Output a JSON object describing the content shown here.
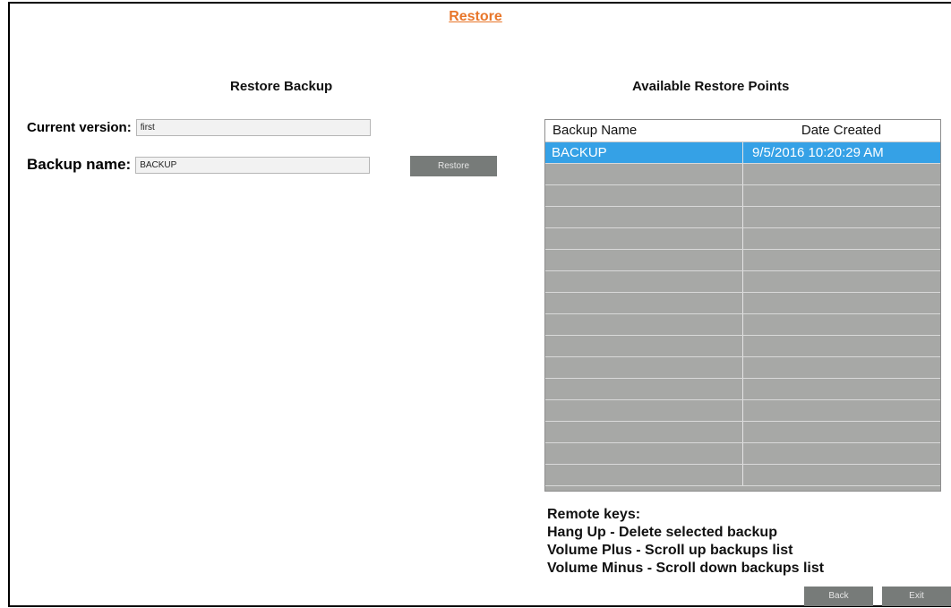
{
  "page": {
    "title": "Restore"
  },
  "left": {
    "title": "Restore Backup",
    "current_version_label": "Current version:",
    "current_version_value": "first",
    "backup_name_label": "Backup name:",
    "backup_name_value": "BACKUP",
    "restore_button": "Restore"
  },
  "right": {
    "title": "Available Restore Points",
    "columns": [
      "Backup Name",
      "Date Created"
    ],
    "rows": [
      {
        "name": "BACKUP",
        "date": "9/5/2016 10:20:29 AM",
        "selected": true
      }
    ],
    "empty_row_count": 15
  },
  "remote": {
    "title": "Remote keys:",
    "lines": [
      "Hang Up - Delete selected backup",
      "Volume Plus - Scroll up backups list",
      "Volume Minus - Scroll down backups list"
    ]
  },
  "footer": {
    "back": "Back",
    "exit": "Exit"
  },
  "colors": {
    "title_link": "#e8762a",
    "button_bg": "#777b79",
    "table_bg": "#a7a8a6",
    "selected_row": "#35a1e6"
  }
}
